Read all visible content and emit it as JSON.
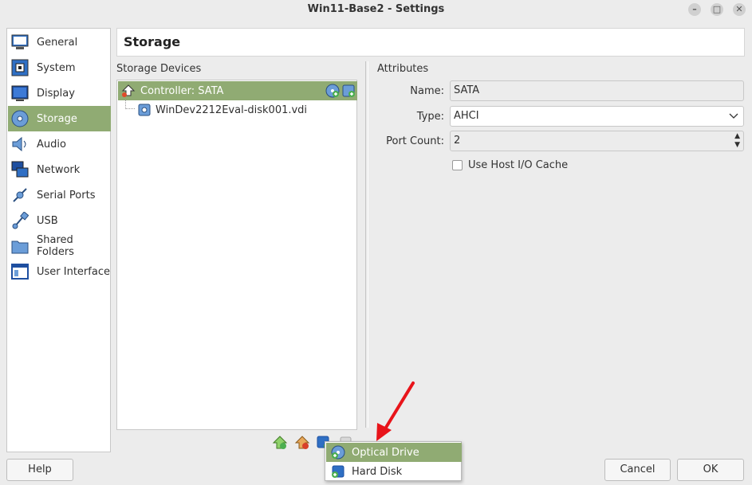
{
  "window": {
    "title": "Win11-Base2 - Settings"
  },
  "sidebar": {
    "items": [
      {
        "label": "General",
        "icon": "general-icon"
      },
      {
        "label": "System",
        "icon": "system-icon"
      },
      {
        "label": "Display",
        "icon": "display-icon"
      },
      {
        "label": "Storage",
        "icon": "storage-icon",
        "active": true
      },
      {
        "label": "Audio",
        "icon": "audio-icon"
      },
      {
        "label": "Network",
        "icon": "network-icon"
      },
      {
        "label": "Serial Ports",
        "icon": "serial-ports-icon"
      },
      {
        "label": "USB",
        "icon": "usb-icon"
      },
      {
        "label": "Shared Folders",
        "icon": "shared-folders-icon"
      },
      {
        "label": "User Interface",
        "icon": "user-interface-icon"
      }
    ]
  },
  "page": {
    "title": "Storage"
  },
  "storage_devices": {
    "label": "Storage Devices",
    "controller": "Controller: SATA",
    "disk": "WinDev2212Eval-disk001.vdi"
  },
  "attributes": {
    "label": "Attributes",
    "name_label": "Name:",
    "name_value": "SATA",
    "type_label": "Type:",
    "type_value": "AHCI",
    "port_count_label": "Port Count:",
    "port_count_value": "2",
    "host_io_cache_label": "Use Host I/O Cache"
  },
  "add_menu": {
    "items": [
      {
        "label": "Optical Drive"
      },
      {
        "label": "Hard Disk"
      }
    ]
  },
  "buttons": {
    "help": "Help",
    "cancel": "Cancel",
    "ok": "OK"
  },
  "colors": {
    "selection": "#90ab73",
    "arrow": "#e8141a"
  }
}
